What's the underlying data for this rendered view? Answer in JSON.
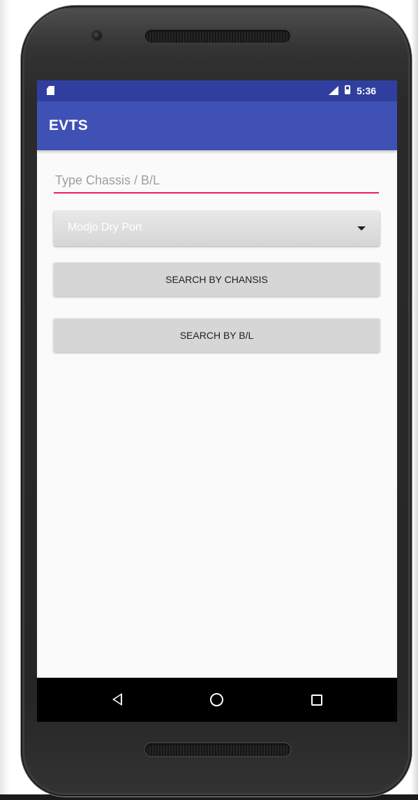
{
  "status_bar": {
    "time": "5:36",
    "icons": [
      "sd-card-icon",
      "signal-icon",
      "battery-icon"
    ]
  },
  "app_bar": {
    "title": "EVTS",
    "color": "#3f51b5",
    "status_color": "#303f9f"
  },
  "form": {
    "search_placeholder": "Type Chassis / B/L",
    "search_value": "",
    "port_selected": "Modjo  Dry Port",
    "search_chassis_label": "SEARCH BY CHANSIS",
    "search_bl_label": "SEARCH BY B/L",
    "accent_color": "#e91e63"
  },
  "nav_bar": {
    "icons": [
      "back-icon",
      "home-icon",
      "recents-icon"
    ]
  }
}
